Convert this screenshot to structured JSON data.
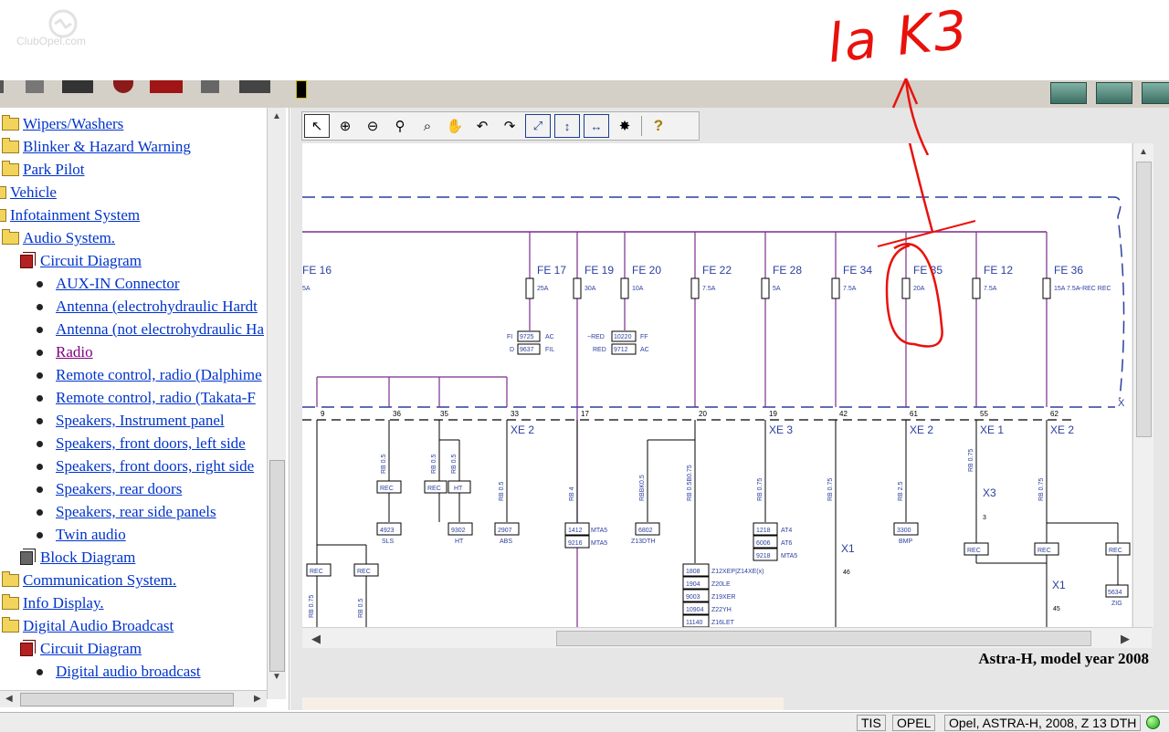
{
  "logo": {
    "text": "ClubOpel.com"
  },
  "annotation": {
    "text": "la K3"
  },
  "tree": {
    "items": [
      {
        "label": "Wipers/Washers",
        "icon": "folder-icon",
        "level": 1
      },
      {
        "label": "Blinker & Hazard Warning",
        "icon": "folder-icon",
        "level": 1
      },
      {
        "label": "Park Pilot",
        "icon": "folder-icon",
        "level": 1
      },
      {
        "label": "Vehicle",
        "icon": "folder-icon",
        "level": 0
      },
      {
        "label": "Infotainment System",
        "icon": "folder-icon",
        "level": 0
      },
      {
        "label": "Audio System.",
        "icon": "folder-open-icon",
        "level": 1
      },
      {
        "label": "Circuit Diagram",
        "icon": "book-icon",
        "level": 2
      },
      {
        "label": "AUX-IN Connector",
        "icon": "bullet-icon",
        "level": 3
      },
      {
        "label": "Antenna (electrohydraulic Hardt",
        "icon": "bullet-icon",
        "level": 3
      },
      {
        "label": "Antenna (not electrohydraulic Ha",
        "icon": "bullet-icon",
        "level": 3
      },
      {
        "label": "Radio",
        "icon": "bullet-icon",
        "level": 3,
        "visited": true
      },
      {
        "label": "Remote control, radio (Dalphime",
        "icon": "bullet-icon",
        "level": 3
      },
      {
        "label": "Remote control, radio (Takata-F",
        "icon": "bullet-icon",
        "level": 3
      },
      {
        "label": "Speakers, Instrument panel",
        "icon": "bullet-icon",
        "level": 3
      },
      {
        "label": "Speakers, front doors, left side",
        "icon": "bullet-icon",
        "level": 3
      },
      {
        "label": "Speakers, front doors, right side",
        "icon": "bullet-icon",
        "level": 3
      },
      {
        "label": "Speakers, rear doors",
        "icon": "bullet-icon",
        "level": 3
      },
      {
        "label": "Speakers, rear side panels",
        "icon": "bullet-icon",
        "level": 3
      },
      {
        "label": "Twin audio",
        "icon": "bullet-icon",
        "level": 3
      },
      {
        "label": "Block Diagram",
        "icon": "book-icon",
        "level": 2
      },
      {
        "label": "Communication System.",
        "icon": "folder-icon",
        "level": 1
      },
      {
        "label": "Info Display.",
        "icon": "folder-icon",
        "level": 1
      },
      {
        "label": "Digital Audio Broadcast",
        "icon": "folder-open-icon",
        "level": 1
      },
      {
        "label": "Circuit Diagram",
        "icon": "book-icon",
        "level": 2
      },
      {
        "label": "Digital audio broadcast",
        "icon": "bullet-icon",
        "level": 3
      }
    ]
  },
  "diagram_toolbar": {
    "buttons": [
      {
        "name": "pointer-icon",
        "glyph": "↖",
        "active": true
      },
      {
        "name": "zoom-in-icon",
        "glyph": "⊕"
      },
      {
        "name": "zoom-out-icon",
        "glyph": "⊖"
      },
      {
        "name": "zoom-icon",
        "glyph": "⚲"
      },
      {
        "name": "zoom-window-icon",
        "glyph": "⌕"
      },
      {
        "name": "pan-hand-icon",
        "glyph": "✋"
      },
      {
        "name": "rotate-left-icon",
        "glyph": "↶"
      },
      {
        "name": "rotate-right-icon",
        "glyph": "↷"
      },
      {
        "name": "fit-page-icon",
        "glyph": "⤢",
        "style": "blue"
      },
      {
        "name": "fit-height-icon",
        "glyph": "↕",
        "style": "blue"
      },
      {
        "name": "fit-width-icon",
        "glyph": "↔",
        "style": "blue"
      },
      {
        "name": "highlight-icon",
        "glyph": "✸"
      },
      {
        "name": "help-icon",
        "glyph": "?",
        "style": "help"
      }
    ]
  },
  "fuses": [
    {
      "id": "FE 16",
      "rating": "5A"
    },
    {
      "id": "FE 17",
      "rating": "25A"
    },
    {
      "id": "FE 19",
      "rating": "30A"
    },
    {
      "id": "FE 20",
      "rating": "10A"
    },
    {
      "id": "FE 22",
      "rating": "7.5A"
    },
    {
      "id": "FE 28",
      "rating": "5A"
    },
    {
      "id": "FE 34",
      "rating": "7.5A"
    },
    {
      "id": "FE 35",
      "rating": "20A"
    },
    {
      "id": "FE 12",
      "rating": "7.5A"
    },
    {
      "id": "FE 36",
      "rating": "15A 7.5A",
      "notes": "~REC REC"
    }
  ],
  "connectors": {
    "xe2a": "XE 2",
    "xe3": "XE 3",
    "xe2b": "XE 2",
    "xe1": "XE 1",
    "xe2c": "XE 2",
    "x": "X",
    "x1a": "X1",
    "x1b": "X1",
    "x3": "X3",
    "pins": [
      "9",
      "36",
      "35",
      "33",
      "17",
      "20",
      "19",
      "42",
      "61",
      "55",
      "62",
      "46",
      "45",
      "3"
    ]
  },
  "codes": {
    "fe17a": "9725",
    "fe17a_l": "FI",
    "fe17a_r": "AC",
    "fe17b": "9637",
    "fe17b_l": "D",
    "fe17b_r": "FIL",
    "fe20a": "10220",
    "fe20a_l": "~RED",
    "fe20a_r": "FF",
    "fe20b": "9712",
    "fe20b_l": "RED",
    "fe20b_r": "AC",
    "c4923": "4923",
    "sls": "SLS",
    "c9302": "9302",
    "ht": "HT",
    "c2907": "2907",
    "abs": "ABS",
    "c1412": "1412",
    "mta5a": "MTA5",
    "c9216": "9216",
    "mta5b": "MTA5",
    "c6802": "6802",
    "z13dth": "Z13DTH",
    "c1218": "1218",
    "at4": "AT4",
    "c6006": "6006",
    "at6": "AT6",
    "c9218": "9218",
    "mta5c": "MTA5",
    "c3300": "3300",
    "bmp": "BMP",
    "c5634": "5634",
    "zig": "ZIG",
    "c1808": "1808",
    "z12": "Z12XEP|Z14XE(x)",
    "c1904": "1904",
    "z20le": "Z20LE",
    "c9003": "9003",
    "z19xer": "Z19XER",
    "c10904": "10904",
    "z22yh": "Z22YH",
    "c11140": "11140",
    "z16let": "Z16LET",
    "rec": "REC",
    "ht_box": "HT"
  },
  "wires": {
    "rb05a": "RB 0.5",
    "rb05b": "RB 0.5",
    "rb05c": "RB 0.5",
    "rb05d": "RB 0.5",
    "rb4": "RB 4",
    "rbbk05": "RBBK0.5",
    "rb05075": "RB 0.5B0.75",
    "rb075a": "RB 0.75",
    "rb075b": "RB 0.75",
    "rb25": "RB 2.5",
    "rb075c": "RB 0.75",
    "rb075d": "RB 0.75",
    "rb075e": "RB 0.75",
    "rb05e": "RB 0.5"
  },
  "caption": {
    "text": "Astra-H, model year 2008"
  },
  "status": {
    "app": "TIS",
    "brand": "OPEL",
    "vehicle": "Opel, ASTRA-H, 2008, Z 13 DTH"
  }
}
